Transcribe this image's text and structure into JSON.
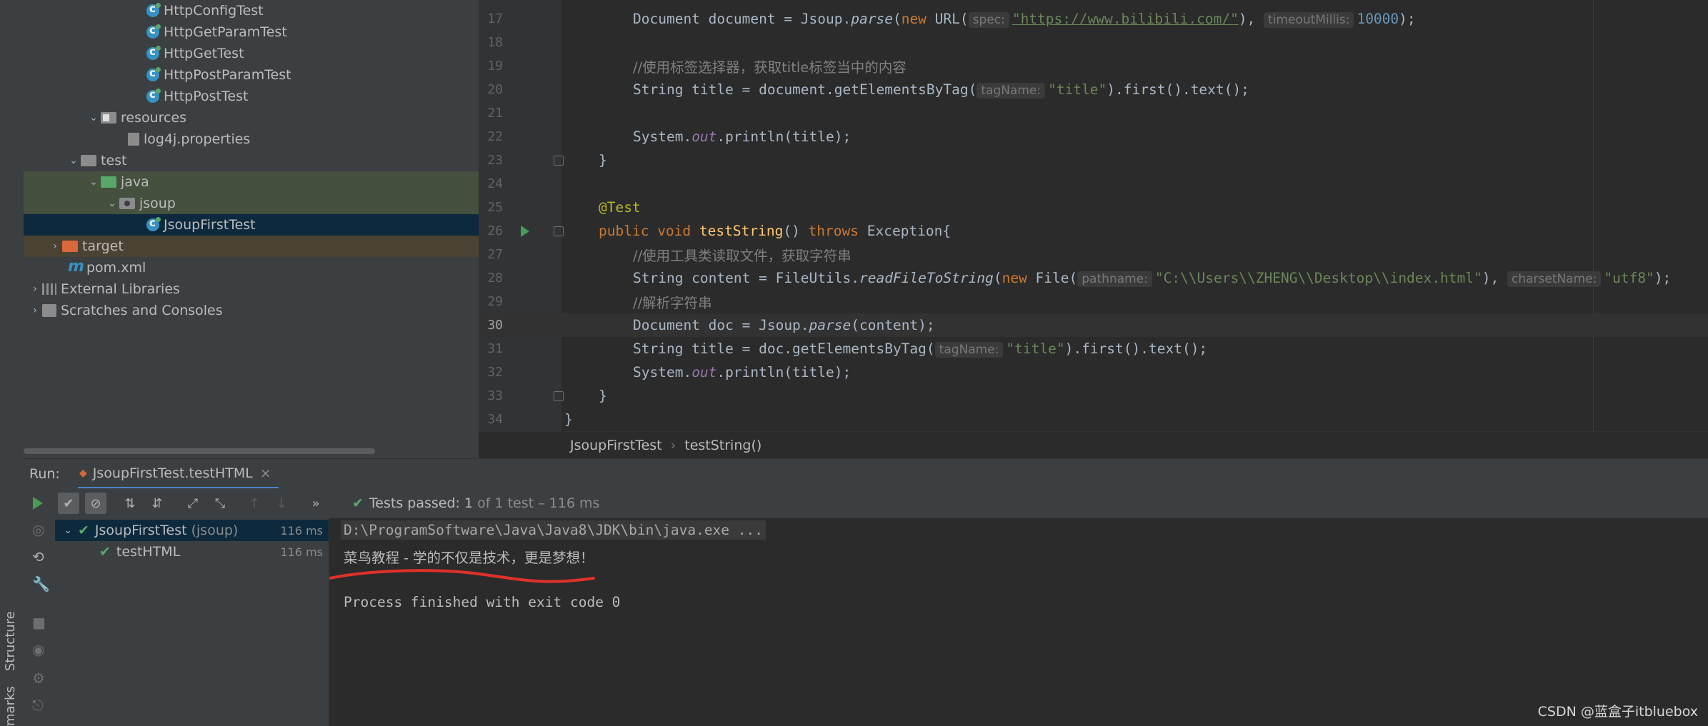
{
  "side_tabs": {
    "structure": "Structure",
    "bookmarks": "marks"
  },
  "project_tree": [
    {
      "label": "HttpConfigTest",
      "icon": "java-class-icon"
    },
    {
      "label": "HttpGetParamTest",
      "icon": "java-class-icon"
    },
    {
      "label": "HttpGetTest",
      "icon": "java-class-icon"
    },
    {
      "label": "HttpPostParamTest",
      "icon": "java-class-icon"
    },
    {
      "label": "HttpPostTest",
      "icon": "java-class-icon"
    },
    {
      "label": "resources",
      "icon": "resources-folder-icon"
    },
    {
      "label": "log4j.properties",
      "icon": "properties-file-icon"
    },
    {
      "label": "test",
      "icon": "folder-icon"
    },
    {
      "label": "java",
      "icon": "test-source-folder-icon"
    },
    {
      "label": "jsoup",
      "icon": "package-icon"
    },
    {
      "label": "JsoupFirstTest",
      "icon": "java-class-icon"
    },
    {
      "label": "target",
      "icon": "excluded-folder-icon"
    },
    {
      "label": "pom.xml",
      "icon": "maven-icon"
    },
    {
      "label": "External Libraries",
      "icon": "libraries-icon"
    },
    {
      "label": "Scratches and Consoles",
      "icon": "scratches-icon"
    }
  ],
  "editor": {
    "line_numbers": [
      "17",
      "18",
      "19",
      "20",
      "21",
      "22",
      "23",
      "24",
      "25",
      "26",
      "27",
      "28",
      "29",
      "30",
      "31",
      "32",
      "33",
      "34"
    ],
    "l17": {
      "a": "Document document = Jsoup.",
      "parse": "parse",
      "b": "(",
      "new": "new",
      "c": " URL(",
      "hint1": "spec:",
      "url": "\"https://www.bilibili.com/\"",
      "d": "), ",
      "hint2": "timeoutMillis:",
      "num": "10000",
      "e": ");"
    },
    "l19": "//使用标签选择器，获取title标签当中的内容",
    "l20": {
      "a": "String title = document.getElementsByTag(",
      "hint": "tagName:",
      "str": "\"title\"",
      "b": ").first().text();"
    },
    "l22": {
      "a": "System.",
      "out": "out",
      "b": ".println(title);"
    },
    "l23": "}",
    "l25": "@Test",
    "l26": {
      "public": "public",
      "void": "void",
      "name": "testString",
      "a": "() ",
      "throws": "throws",
      "b": " Exception{"
    },
    "l27": "//使用工具类读取文件，获取字符串",
    "l28": {
      "a": "String content = FileUtils.",
      "method": "readFileToString",
      "b": "(",
      "new": "new",
      "c": " File(",
      "hint1": "pathname:",
      "str1": "\"C:\\\\Users\\\\ZHENG\\\\Desktop\\\\index.html\"",
      "d": "), ",
      "hint2": "charsetName:",
      "str2": "\"utf8\"",
      "e": ");"
    },
    "l29": "//解析字符串",
    "l30": {
      "a": "Document doc = Jsoup.",
      "parse": "parse",
      "b": "(content);"
    },
    "l31": {
      "a": "String title = doc.getElementsByTag(",
      "hint": "tagName:",
      "str": "\"title\"",
      "b": ").first().text();"
    },
    "l32": {
      "a": "System.",
      "out": "out",
      "b": ".println(title);"
    },
    "l33": "}",
    "l34": "}"
  },
  "breadcrumbs": {
    "class": "JsoupFirstTest",
    "separator": "›",
    "method": "testString()"
  },
  "run_panel": {
    "label": "Run:",
    "tab": "JsoupFirstTest.testHTML",
    "tests_passed": "Tests passed:",
    "count": "1",
    "of_total": "of 1 test – 116 ms",
    "more": "»"
  },
  "test_tree": [
    {
      "name": "JsoupFirstTest",
      "pkg": "(jsoup)",
      "time": "116 ms"
    },
    {
      "name": "testHTML",
      "pkg": "",
      "time": "116 ms"
    }
  ],
  "console": {
    "cmd": "D:\\ProgramSoftware\\Java\\Java8\\JDK\\bin\\java.exe ...",
    "output": "菜鸟教程 - 学的不仅是技术，更是梦想！",
    "exit": "Process finished with exit code 0"
  },
  "watermark": "CSDN @蓝盒子itbluebox",
  "colors": {
    "keyword": "#cc7832",
    "string": "#6a8759",
    "number": "#6897bb",
    "accent": "#4a88c7",
    "passed": "#59a869",
    "annotation_red": "#e0312b"
  }
}
